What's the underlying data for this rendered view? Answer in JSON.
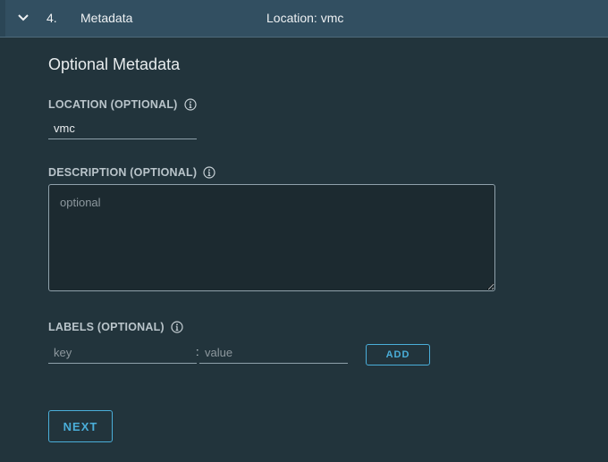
{
  "header": {
    "step_number": "4.",
    "step_title": "Metadata",
    "step_summary": "Location: vmc",
    "toggle_icon": "chevron-down-icon"
  },
  "section": {
    "title": "Optional Metadata"
  },
  "location": {
    "label": "LOCATION (OPTIONAL)",
    "value": "vmc",
    "info_icon": "info-icon"
  },
  "description": {
    "label": "DESCRIPTION (OPTIONAL)",
    "placeholder": "optional",
    "value": "",
    "info_icon": "info-icon"
  },
  "labels": {
    "label": "LABELS (OPTIONAL)",
    "key_placeholder": "key",
    "separator": ":",
    "value_placeholder": "value",
    "add_label": "ADD",
    "info_icon": "info-icon"
  },
  "footer": {
    "next_label": "NEXT"
  },
  "colors": {
    "background": "#22343c",
    "header_background": "#324f61",
    "accent": "#4aaed9",
    "label_text": "#b9c4ca"
  }
}
